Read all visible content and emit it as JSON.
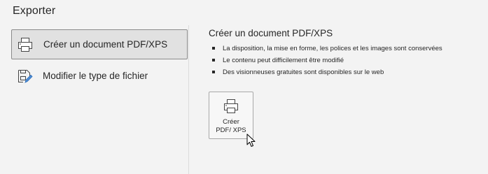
{
  "page": {
    "title": "Exporter"
  },
  "sidebar": {
    "items": [
      {
        "label": "Créer un document PDF/XPS",
        "icon": "printer-icon",
        "selected": true
      },
      {
        "label": "Modifier le type de fichier",
        "icon": "file-edit-icon",
        "selected": false
      }
    ]
  },
  "main": {
    "section_title": "Créer un document PDF/XPS",
    "bullets": [
      "La disposition, la mise en forme, les polices et les images sont conservées",
      "Le contenu peut difficilement être modifié",
      "Des visionneuses gratuites sont disponibles sur le web"
    ],
    "create_button": {
      "label": "Créer PDF/ XPS",
      "icon": "printer-icon"
    }
  },
  "colors": {
    "background": "#f3f3f3",
    "selected_background": "#e1e1e1",
    "selected_border": "#8a8a8a",
    "text": "#262626"
  }
}
